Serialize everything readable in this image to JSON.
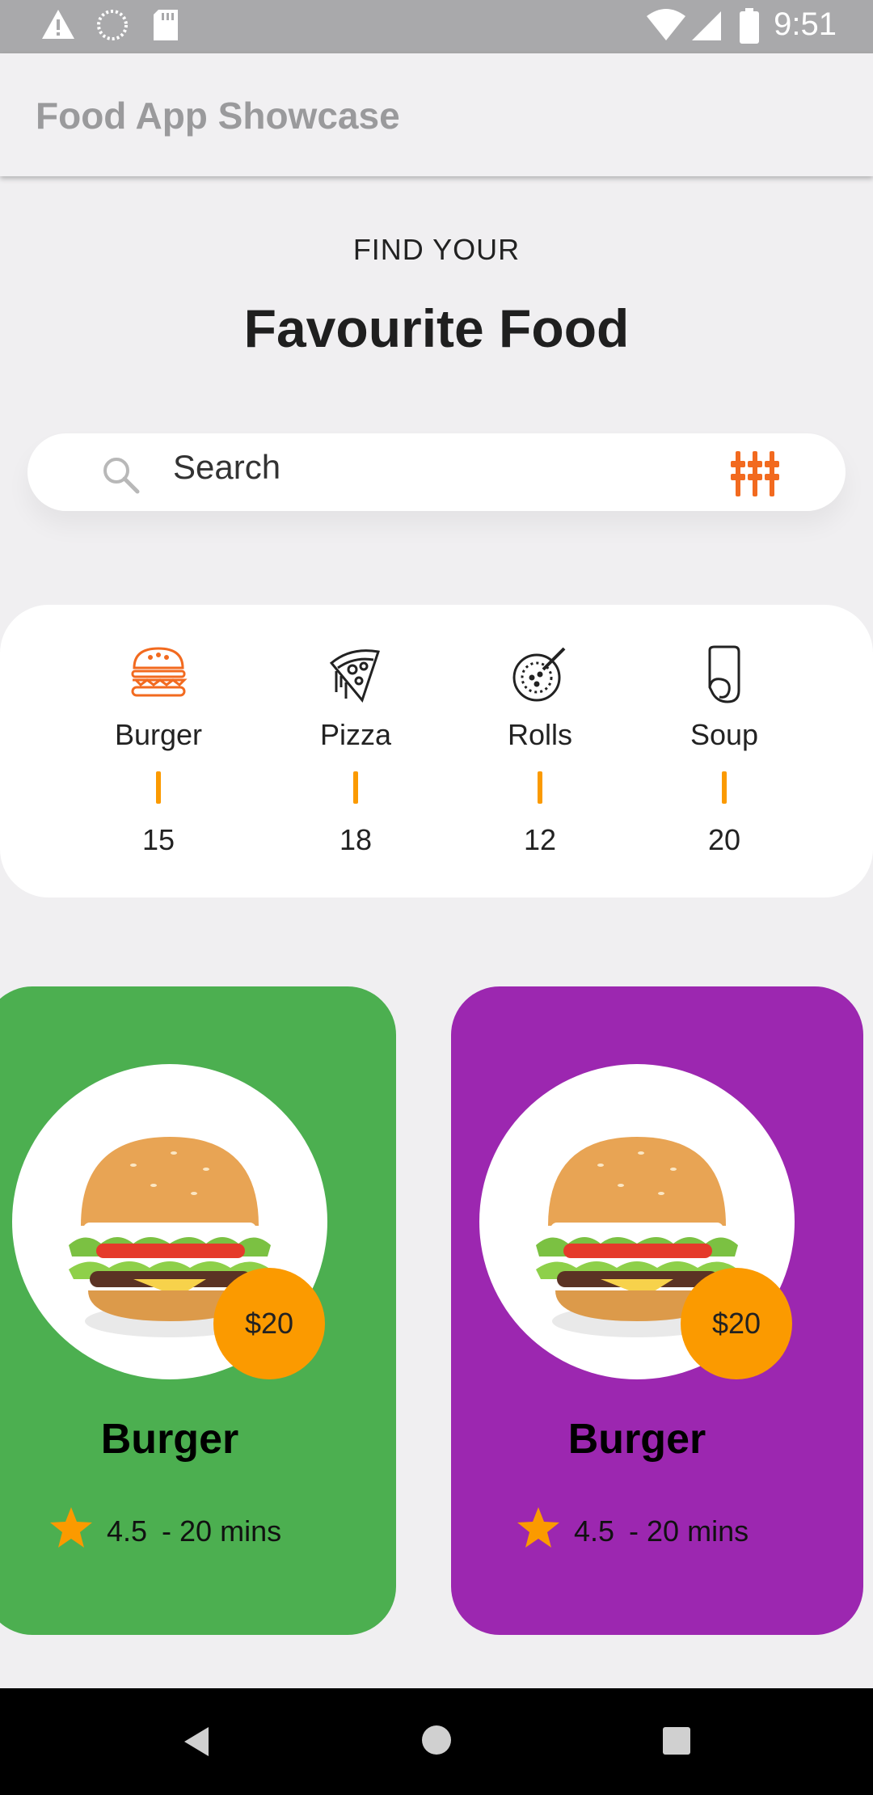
{
  "status_bar": {
    "time": "9:51"
  },
  "app_bar": {
    "title": "Food App Showcase"
  },
  "header": {
    "subtitle": "FIND YOUR",
    "title": "Favourite Food"
  },
  "search": {
    "placeholder": "Search"
  },
  "categories": [
    {
      "name": "Burger",
      "count": "15",
      "icon": "burger-icon"
    },
    {
      "name": "Pizza",
      "count": "18",
      "icon": "pizza-icon"
    },
    {
      "name": "Rolls",
      "count": "12",
      "icon": "rolls-icon"
    },
    {
      "name": "Soup",
      "count": "20",
      "icon": "soup-icon"
    }
  ],
  "cards": [
    {
      "title": "Burger",
      "price": "$20",
      "rating": "4.5",
      "time": " - 20 mins",
      "color": "#4caf50"
    },
    {
      "title": "Burger",
      "price": "$20",
      "rating": "4.5",
      "time": " - 20 mins",
      "color": "#9c27b0"
    }
  ],
  "colors": {
    "accent": "#fb9a00",
    "filter_icon": "#f26a1f"
  }
}
